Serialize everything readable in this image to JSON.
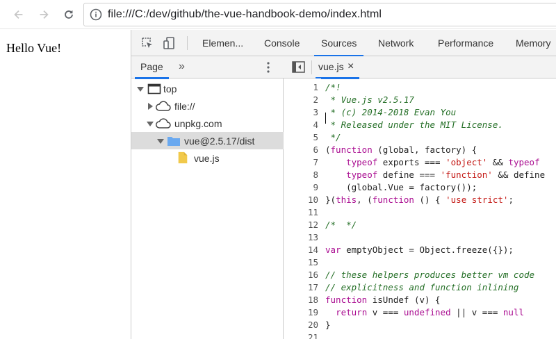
{
  "browser": {
    "url": "file:///C:/dev/github/the-vue-handbook-demo/index.html",
    "icons": [
      "back-arrow-icon",
      "forward-arrow-icon",
      "reload-icon",
      "info-icon"
    ]
  },
  "page": {
    "text": "Hello Vue!"
  },
  "devtools": {
    "tabs": [
      "Elemen...",
      "Console",
      "Sources",
      "Network",
      "Performance",
      "Memory"
    ],
    "active_tab": "Sources",
    "navigator": {
      "tab": "Page",
      "more": "»",
      "tree": [
        {
          "label": "top",
          "icon": "frame-icon",
          "expanded": true
        },
        {
          "label": "file://",
          "icon": "cloud-icon",
          "expanded": false
        },
        {
          "label": "unpkg.com",
          "icon": "cloud-icon",
          "expanded": true
        },
        {
          "label": "vue@2.5.17/dist",
          "icon": "folder-icon",
          "expanded": true,
          "selected": true
        },
        {
          "label": "vue.js",
          "icon": "file-icon"
        }
      ]
    },
    "editor": {
      "file_tab": "vue.js",
      "close": "×",
      "lines": [
        "/*!",
        " * Vue.js v2.5.17",
        " * (c) 2014-2018 Evan You",
        " * Released under the MIT License.",
        " */",
        "(function (global, factory) {",
        "    typeof exports === 'object' && typeof",
        "    typeof define === 'function' && define",
        "    (global.Vue = factory());",
        "}(this, (function () { 'use strict';",
        "",
        "/*  */",
        "",
        "var emptyObject = Object.freeze({});",
        "",
        "// these helpers produces better vm code",
        "// explicitness and function inlining",
        "function isUndef (v) {",
        "  return v === undefined || v === null",
        "}",
        ""
      ],
      "line_numbers": [
        "1",
        "2",
        "3",
        "4",
        "5",
        "6",
        "7",
        "8",
        "9",
        "10",
        "11",
        "12",
        "13",
        "14",
        "15",
        "16",
        "17",
        "18",
        "19",
        "20",
        "21"
      ]
    }
  },
  "colors": {
    "accent": "#1a73e8",
    "comment": "#236e25",
    "keyword": "#aa0d91",
    "string": "#c41a16",
    "folder": "#6aa9f0",
    "file": "#f1c94b"
  }
}
